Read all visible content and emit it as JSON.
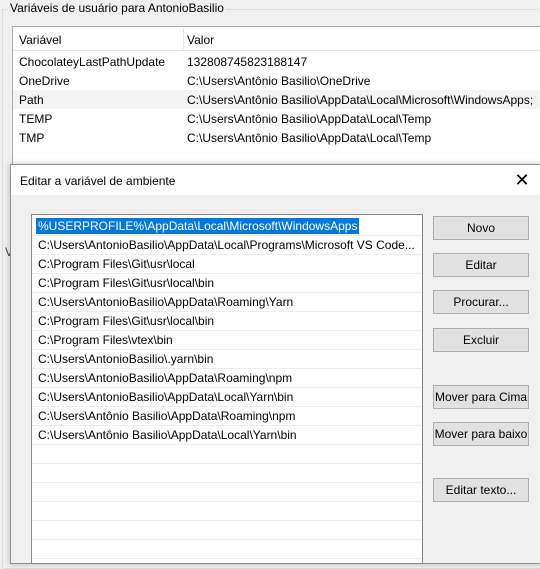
{
  "user_vars": {
    "group_title": "Variáveis de usuário para AntonioBasilio",
    "col_var": "Variável",
    "col_val": "Valor",
    "rows": [
      {
        "name": "ChocolateyLastPathUpdate",
        "value": "132808745823188147"
      },
      {
        "name": "OneDrive",
        "value": "C:\\Users\\Antônio Basilio\\OneDrive"
      },
      {
        "name": "Path",
        "value": "C:\\Users\\Antônio Basilio\\AppData\\Local\\Microsoft\\WindowsApps;"
      },
      {
        "name": "TEMP",
        "value": "C:\\Users\\Antônio Basilio\\AppData\\Local\\Temp"
      },
      {
        "name": "TMP",
        "value": "C:\\Users\\Antônio Basilio\\AppData\\Local\\Temp"
      }
    ],
    "v_fragment": "V"
  },
  "dialog": {
    "title": "Editar a variável de ambiente",
    "close_glyph": "✕",
    "paths": [
      "%USERPROFILE%\\AppData\\Local\\Microsoft\\WindowsApps",
      "C:\\Users\\AntonioBasilio\\AppData\\Local\\Programs\\Microsoft VS Code...",
      "C:\\Program Files\\Git\\usr\\local",
      "C:\\Program Files\\Git\\usr\\local\\bin",
      "C:\\Users\\AntonioBasilio\\AppData\\Roaming\\Yarn",
      "C:\\Program Files\\Git\\usr\\local\\bin",
      "C:\\Program Files\\vtex\\bin",
      "C:\\Users\\AntonioBasilio\\.yarn\\bin",
      "C:\\Users\\AntonioBasilio\\AppData\\Roaming\\npm",
      "C:\\Users\\AntonioBasilio\\AppData\\Local\\Yarn\\bin",
      "C:\\Users\\Antônio Basilio\\AppData\\Roaming\\npm",
      "C:\\Users\\Antônio Basilio\\AppData\\Local\\Yarn\\bin"
    ],
    "buttons": {
      "new": "Novo",
      "edit": "Editar",
      "browse": "Procurar...",
      "delete": "Excluir",
      "move_up": "Mover para Cima",
      "move_down": "Mover para baixo",
      "edit_text": "Editar texto..."
    },
    "selection_color": "#0078d7"
  }
}
